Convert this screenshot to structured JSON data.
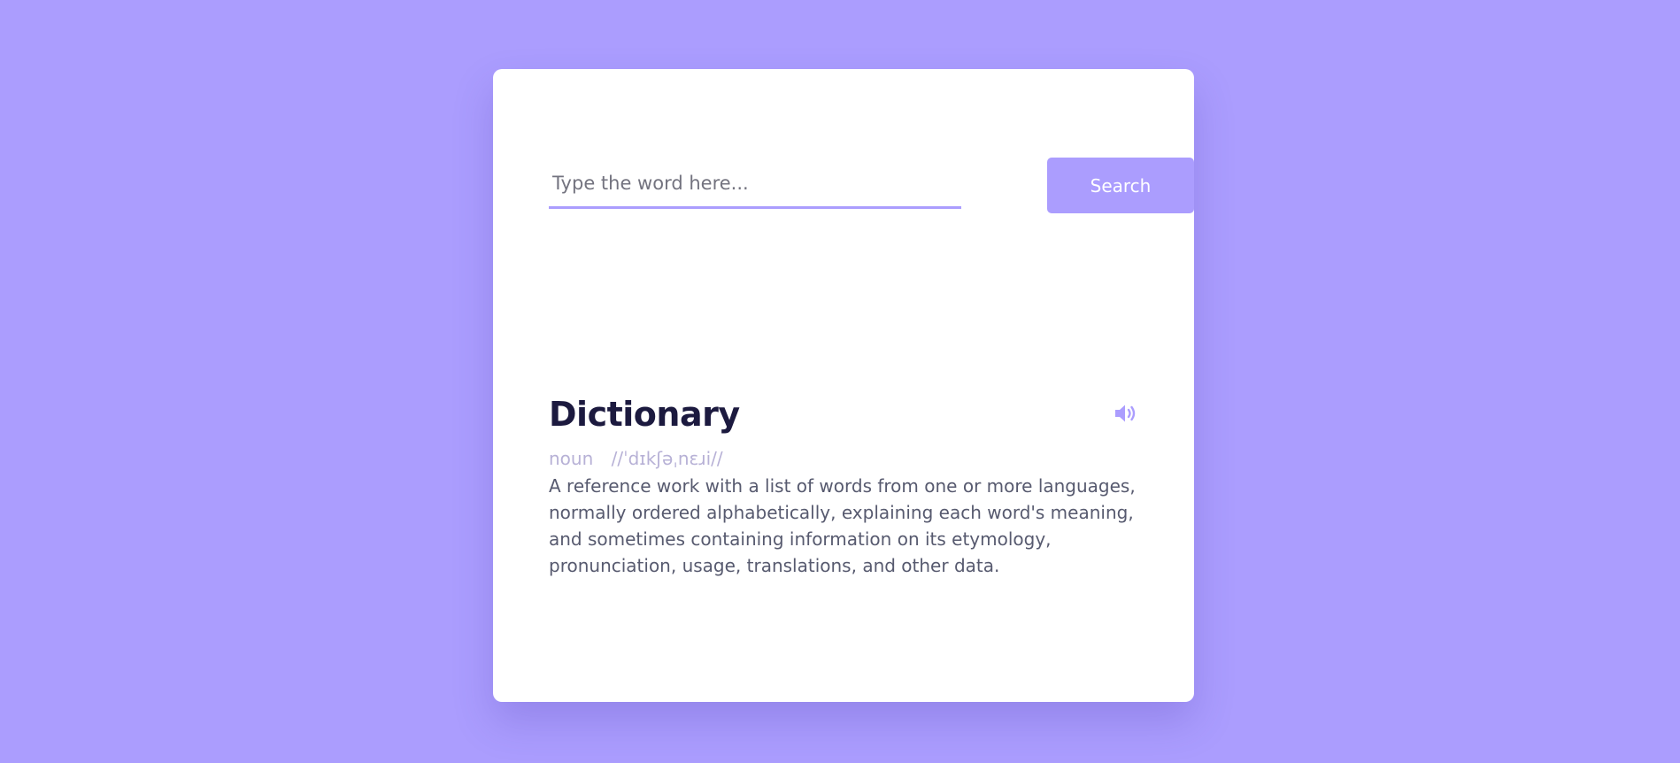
{
  "search": {
    "placeholder": "Type the word here...",
    "value": "",
    "button_label": "Search"
  },
  "result": {
    "word": "Dictionary",
    "part_of_speech": "noun",
    "phonetic": "//ˈdɪkʃəˌnɛɹi//",
    "definition": "A reference work with a list of words from one or more languages, normally ordered alphabetically, explaining each word's meaning, and sometimes containing information on its etymology, pronunciation, usage, translations, and other data.",
    "sound_icon": "volume-icon"
  },
  "colors": {
    "background": "#ab9dfe",
    "accent": "#ab9dfe",
    "card": "#ffffff",
    "word": "#1c1a3f",
    "meta": "#b7b1d6",
    "definition": "#575a6f"
  }
}
